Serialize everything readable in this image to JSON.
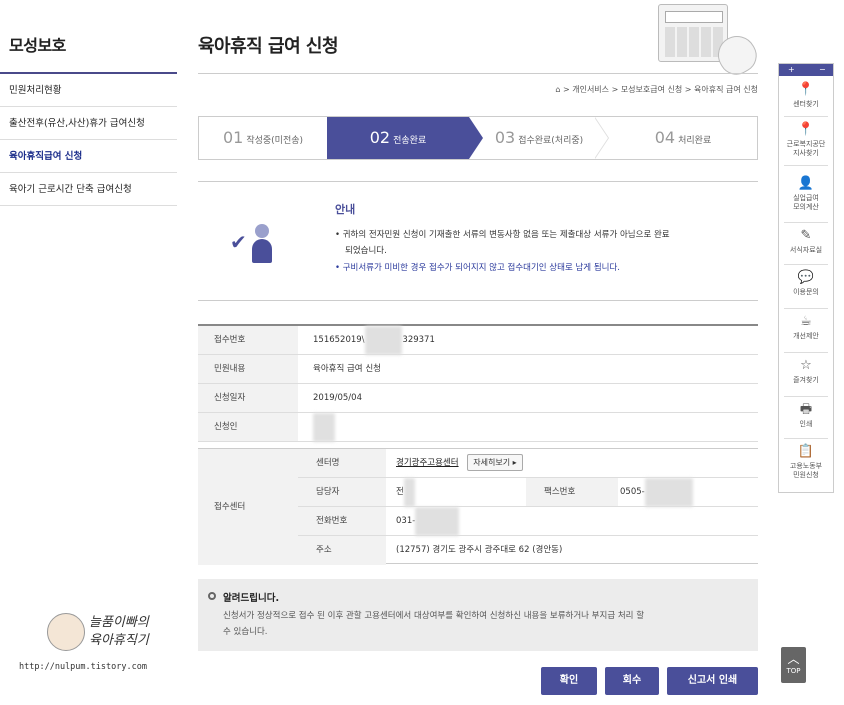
{
  "left": {
    "title": "모성보호",
    "items": [
      {
        "label": "민원처리현황"
      },
      {
        "label": "출산전후(유산,사산)휴가 급여신청"
      },
      {
        "label": "육아휴직급여 신청"
      },
      {
        "label": "육아기 근로시간 단축 급여신청"
      }
    ],
    "logo_line1": "늘품이빠의",
    "logo_line2": "육아휴직기",
    "logo_url": "http://nulpum.tistory.com"
  },
  "header": {
    "title": "육아휴직 급여 신청",
    "breadcrumb": "> 개인서비스 > 모성보호급여 신청 > 육아휴직 급여 신청"
  },
  "steps": [
    {
      "num": "01",
      "label": "작성중(미전송)"
    },
    {
      "num": "02",
      "label": "전송완료"
    },
    {
      "num": "03",
      "label": "접수완료(처리중)"
    },
    {
      "num": "04",
      "label": "처리완료"
    }
  ],
  "notice": {
    "title": "안내",
    "line1": "• 귀하의 전자민원 신청이 기재출한 서류의 변동사항 없음 또는 제출대상 서류가 아님으로 완료",
    "line2": "되었습니다.",
    "line3": "• 구비서류가 미비한 경우 접수가 되어지지 않고 접수대기인 상태로 남게 됩니다."
  },
  "info": {
    "rows": [
      {
        "label": "접수번호",
        "value_a": "151652019\\",
        "value_b": "329371"
      },
      {
        "label": "민원내용",
        "value": "육아휴직 급여 신청"
      },
      {
        "label": "신청일자",
        "value": "2019/05/04"
      },
      {
        "label": "신청인",
        "value": ""
      }
    ]
  },
  "center": {
    "label": "접수센터",
    "name_label": "센터명",
    "name_value": "경기광주고용센터",
    "detail_button": "자세히보기 ▸",
    "manager_label": "담당자",
    "manager_value": "전",
    "fax_label": "팩스번호",
    "fax_value": "0505-",
    "phone_label": "전화번호",
    "phone_value": "031-",
    "address_label": "주소",
    "address_value": "(12757) 경기도 광주시 광주대로 62 (경안동)"
  },
  "alert": {
    "title": "알려드립니다.",
    "line1": "신청서가 정상적으로 접수 된 이후 관할 고용센터에서 대상여부를 확인하여 신청하신 내용을 보류하거나 부지급 처리 할",
    "line2": "수 있습니다."
  },
  "buttons": {
    "confirm": "확인",
    "withdraw": "회수",
    "print": "신고서 인쇄"
  },
  "quick": {
    "plus": "+",
    "minus": "−",
    "items": [
      {
        "icon": "📍",
        "l1": "센터찾기",
        "l2": ""
      },
      {
        "icon": "📍",
        "l1": "근로복지공단",
        "l2": "지사찾기"
      },
      {
        "icon": "👤",
        "l1": "실업급여",
        "l2": "모의계산"
      },
      {
        "icon": "✎",
        "l1": "서식자료실",
        "l2": ""
      },
      {
        "icon": "💬",
        "l1": "이용문의",
        "l2": ""
      },
      {
        "icon": "☕",
        "l1": "개선제안",
        "l2": ""
      },
      {
        "icon": "☆",
        "l1": "즐겨찾기",
        "l2": ""
      },
      {
        "icon": "🖶",
        "l1": "인쇄",
        "l2": ""
      },
      {
        "icon": "📋",
        "l1": "고용노동부",
        "l2": "민원신청"
      }
    ],
    "top": "TOP"
  },
  "colors": {
    "accent": "#4a4f9a",
    "link": "#2b3a9c"
  }
}
